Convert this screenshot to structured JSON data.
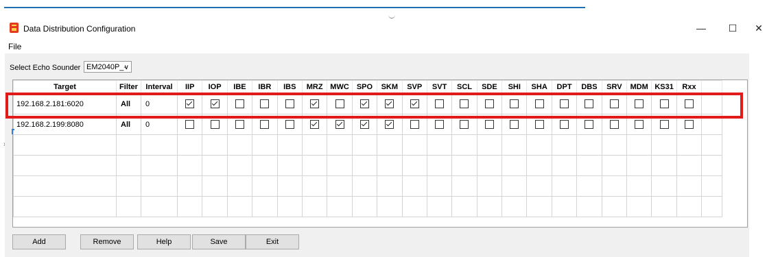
{
  "window": {
    "title": "Data Distribution Configuration",
    "controls": {
      "minimize": "—",
      "maximize": "☐",
      "close": "✕"
    }
  },
  "menu": {
    "file": "File"
  },
  "select": {
    "label": "Select Echo Sounder",
    "value": "EM2040P_-",
    "arrow": "∨"
  },
  "table": {
    "headers": {
      "target": "Target",
      "filter": "Filter",
      "interval": "Interval"
    },
    "datagrams": [
      "IIP",
      "IOP",
      "IBE",
      "IBR",
      "IBS",
      "MRZ",
      "MWC",
      "SPO",
      "SKM",
      "SVP",
      "SVT",
      "SCL",
      "SDE",
      "SHI",
      "SHA",
      "DPT",
      "DBS",
      "SRV",
      "MDM",
      "KS31",
      "Rxx"
    ],
    "rows": [
      {
        "target": "192.168.2.181:6020",
        "filter": "All",
        "interval": "0",
        "checked": [
          1,
          1,
          0,
          0,
          0,
          1,
          0,
          1,
          1,
          1,
          0,
          0,
          0,
          0,
          0,
          0,
          0,
          0,
          0,
          0,
          0
        ]
      },
      {
        "target": "192.168.2.199:8080",
        "filter": "All",
        "interval": "0",
        "checked": [
          0,
          0,
          0,
          0,
          0,
          1,
          1,
          1,
          1,
          0,
          0,
          0,
          0,
          0,
          0,
          0,
          0,
          0,
          0,
          0,
          0
        ]
      }
    ],
    "empty_rows": 4
  },
  "buttons": {
    "add": "Add",
    "remove": "Remove",
    "help": "Help",
    "save": "Save",
    "exit": "Exit"
  },
  "colors": {
    "highlight": "#e11a1a",
    "accent_line": "#1f6fb2"
  }
}
